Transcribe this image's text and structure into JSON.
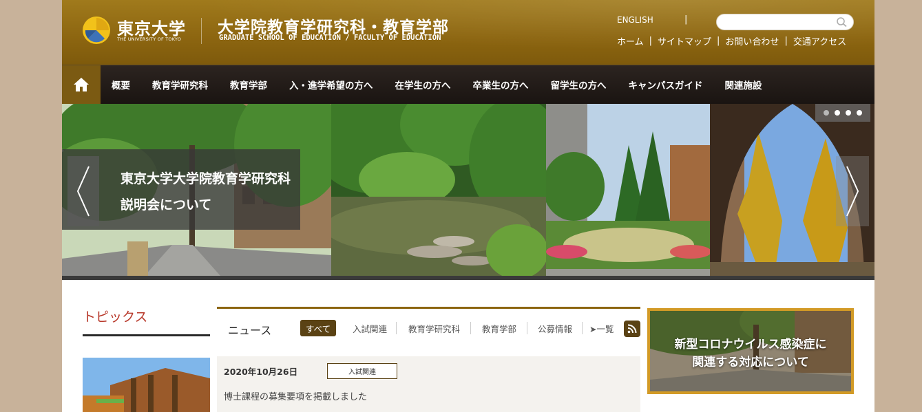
{
  "header": {
    "univ_name_jp": "東京大学",
    "univ_name_en": "THE UNIVERSITY OF TOKYO",
    "school_name_jp": "大学院教育学研究科・教育学部",
    "school_name_en": "GRADUATE SCHOOL OF EDUCATION / FACULTY OF EDUCATION",
    "english_link": "ENGLISH",
    "separator": "|",
    "search": {
      "value": "",
      "placeholder": ""
    },
    "util_links": [
      "ホーム",
      "サイトマップ",
      "お問い合わせ",
      "交通アクセス"
    ]
  },
  "nav": {
    "home_icon": "home-icon",
    "items": [
      "概要",
      "教育学研究科",
      "教育学部",
      "入・進学希望の方へ",
      "在学生の方へ",
      "卒業生の方へ",
      "留学生の方へ",
      "キャンパスガイド",
      "関連施設"
    ]
  },
  "slider": {
    "caption_line1": "東京大学大学院教育学研究科",
    "caption_line2": "説明会について",
    "dot_count": 4,
    "active_dot": 1
  },
  "topics": {
    "title": "トピックス"
  },
  "news": {
    "title": "ニュース",
    "tabs": [
      "すべて",
      "入試関連",
      "教育学研究科",
      "教育学部",
      "公募情報",
      "➤一覧"
    ],
    "items": [
      {
        "date": "2020年10月26日",
        "category": "入試関連",
        "text": "博士課程の募集要項を掲載しました"
      }
    ]
  },
  "banner": {
    "line1": "新型コロナウイルス感染症に",
    "line2": "関連する対応について"
  },
  "colors": {
    "header_gold": "#8c6510",
    "nav_dark": "#1a1411",
    "accent_brown": "#5a4214",
    "topics_red": "#b8392b",
    "banner_border": "#d29a26",
    "page_bg": "#c8b29a"
  }
}
